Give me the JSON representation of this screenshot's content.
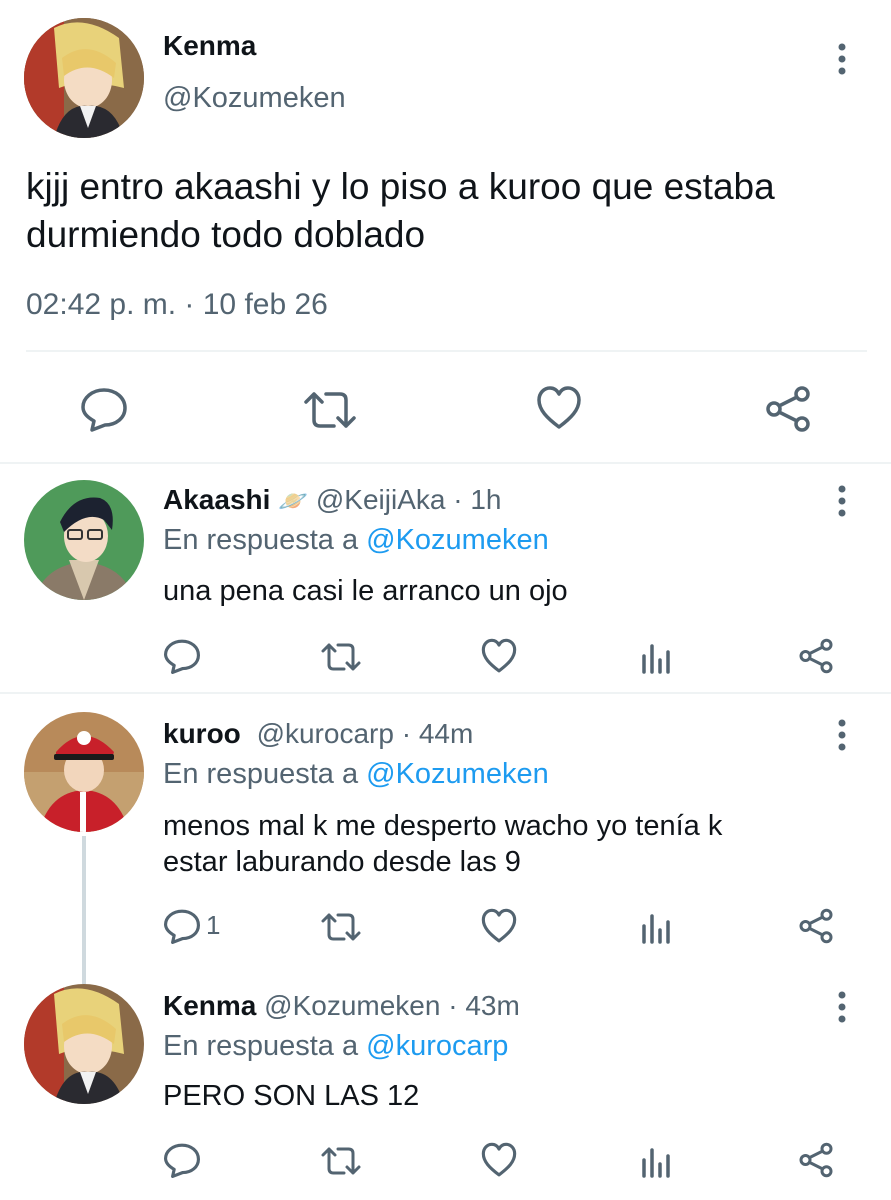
{
  "main_tweet": {
    "display_name": "Kenma",
    "handle": "@Kozumeken",
    "text_line1": "kjjj entro akaashi y lo piso a kuroo que estaba",
    "text_line2": "durmiendo todo doblado",
    "timestamp": "02:42 p. m. · 10 feb 26",
    "icons": [
      "reply-icon",
      "retweet-icon",
      "like-icon",
      "share-icon"
    ]
  },
  "replies": [
    {
      "display_name": "Akaashi",
      "emoji": "🪐",
      "handle": "@KeijiAka",
      "time": "· 1h",
      "reply_prefix": "En respuesta a",
      "reply_to": "@Kozumeken",
      "text_lines": [
        "una pena casi le arranco un ojo"
      ],
      "reply_count": ""
    },
    {
      "display_name": "kuroo",
      "handle": "@kurocarp",
      "time": "· 44m",
      "reply_prefix": "En respuesta a",
      "reply_to": "@Kozumeken",
      "text_lines": [
        "menos mal k me desperto wacho yo tenía k",
        "estar laburando desde las 9"
      ],
      "reply_count": "1"
    },
    {
      "display_name": "Kenma",
      "handle": "@Kozumeken",
      "time": "· 43m",
      "reply_prefix": "En respuesta a",
      "reply_to": "@kurocarp",
      "text_lines": [
        "PERO SON LAS 12"
      ],
      "reply_count": ""
    }
  ],
  "colors": {
    "text": "#0f1419",
    "muted": "#536471",
    "link": "#1d9bf0",
    "divider": "#eff3f4"
  }
}
